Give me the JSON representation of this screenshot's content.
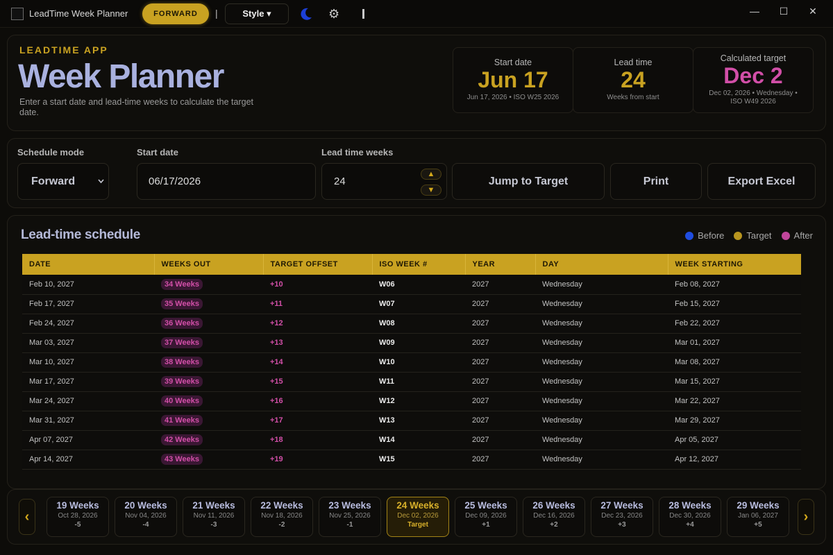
{
  "titlebar": {
    "app_title": "LeadTime Week Planner",
    "mode_pill": "FORWARD",
    "separator": "|",
    "style_button": "Style ▾",
    "gear_glyph": "⚙",
    "minimize": "—",
    "maximize": "☐",
    "close": "✕"
  },
  "header": {
    "kicker": "LEADTIME APP",
    "title": "Week Planner",
    "subtitle": "Enter a start date and lead-time weeks to calculate the target date.",
    "stats": [
      {
        "label": "Start date",
        "value": "Jun 17",
        "sub": "Jun 17, 2026 • ISO W25 2026",
        "color": "#c9a221"
      },
      {
        "label": "Lead time",
        "value": "24",
        "sub": "Weeks from start",
        "color": "#c9a221"
      },
      {
        "label": "Calculated target",
        "value": "Dec 2",
        "sub": "Dec 02, 2026 • Wednesday • ISO W49 2026",
        "color": "#d24fa8"
      }
    ]
  },
  "controls": {
    "mode_label": "Schedule mode",
    "mode_value": "Forward",
    "start_label": "Start date",
    "start_value": "06/17/2026",
    "lead_label": "Lead time weeks",
    "lead_value": "24",
    "jump_button": "Jump to Target",
    "print_button": "Print",
    "export_button": "Export Excel"
  },
  "schedule": {
    "title": "Lead-time schedule",
    "legend": [
      {
        "label": "Before",
        "color": "#1f4de0"
      },
      {
        "label": "Target",
        "color": "#b8951f"
      },
      {
        "label": "After",
        "color": "#c0459a"
      }
    ],
    "columns": [
      "DATE",
      "WEEKS OUT",
      "TARGET OFFSET",
      "ISO WEEK #",
      "YEAR",
      "DAY",
      "WEEK STARTING"
    ],
    "rows": [
      [
        "Feb 10, 2027",
        "34 Weeks",
        "+10",
        "W06",
        "2027",
        "Wednesday",
        "Feb 08, 2027"
      ],
      [
        "Feb 17, 2027",
        "35 Weeks",
        "+11",
        "W07",
        "2027",
        "Wednesday",
        "Feb 15, 2027"
      ],
      [
        "Feb 24, 2027",
        "36 Weeks",
        "+12",
        "W08",
        "2027",
        "Wednesday",
        "Feb 22, 2027"
      ],
      [
        "Mar 03, 2027",
        "37 Weeks",
        "+13",
        "W09",
        "2027",
        "Wednesday",
        "Mar 01, 2027"
      ],
      [
        "Mar 10, 2027",
        "38 Weeks",
        "+14",
        "W10",
        "2027",
        "Wednesday",
        "Mar 08, 2027"
      ],
      [
        "Mar 17, 2027",
        "39 Weeks",
        "+15",
        "W11",
        "2027",
        "Wednesday",
        "Mar 15, 2027"
      ],
      [
        "Mar 24, 2027",
        "40 Weeks",
        "+16",
        "W12",
        "2027",
        "Wednesday",
        "Mar 22, 2027"
      ],
      [
        "Mar 31, 2027",
        "41 Weeks",
        "+17",
        "W13",
        "2027",
        "Wednesday",
        "Mar 29, 2027"
      ],
      [
        "Apr 07, 2027",
        "42 Weeks",
        "+18",
        "W14",
        "2027",
        "Wednesday",
        "Apr 05, 2027"
      ],
      [
        "Apr 14, 2027",
        "43 Weeks",
        "+19",
        "W15",
        "2027",
        "Wednesday",
        "Apr 12, 2027"
      ]
    ]
  },
  "week_strip": {
    "prev_glyph": "‹",
    "next_glyph": "›",
    "weeks": [
      {
        "weeks": "19 Weeks",
        "date": "Oct 28, 2026",
        "offset": "-5",
        "is_target": false
      },
      {
        "weeks": "20 Weeks",
        "date": "Nov 04, 2026",
        "offset": "-4",
        "is_target": false
      },
      {
        "weeks": "21 Weeks",
        "date": "Nov 11, 2026",
        "offset": "-3",
        "is_target": false
      },
      {
        "weeks": "22 Weeks",
        "date": "Nov 18, 2026",
        "offset": "-2",
        "is_target": false
      },
      {
        "weeks": "23 Weeks",
        "date": "Nov 25, 2026",
        "offset": "-1",
        "is_target": false
      },
      {
        "weeks": "24 Weeks",
        "date": "Dec 02, 2026",
        "offset": "Target",
        "is_target": true
      },
      {
        "weeks": "25 Weeks",
        "date": "Dec 09, 2026",
        "offset": "+1",
        "is_target": false
      },
      {
        "weeks": "26 Weeks",
        "date": "Dec 16, 2026",
        "offset": "+2",
        "is_target": false
      },
      {
        "weeks": "27 Weeks",
        "date": "Dec 23, 2026",
        "offset": "+3",
        "is_target": false
      },
      {
        "weeks": "28 Weeks",
        "date": "Dec 30, 2026",
        "offset": "+4",
        "is_target": false
      },
      {
        "weeks": "29 Weeks",
        "date": "Jan 06, 2027",
        "offset": "+5",
        "is_target": false
      }
    ]
  }
}
